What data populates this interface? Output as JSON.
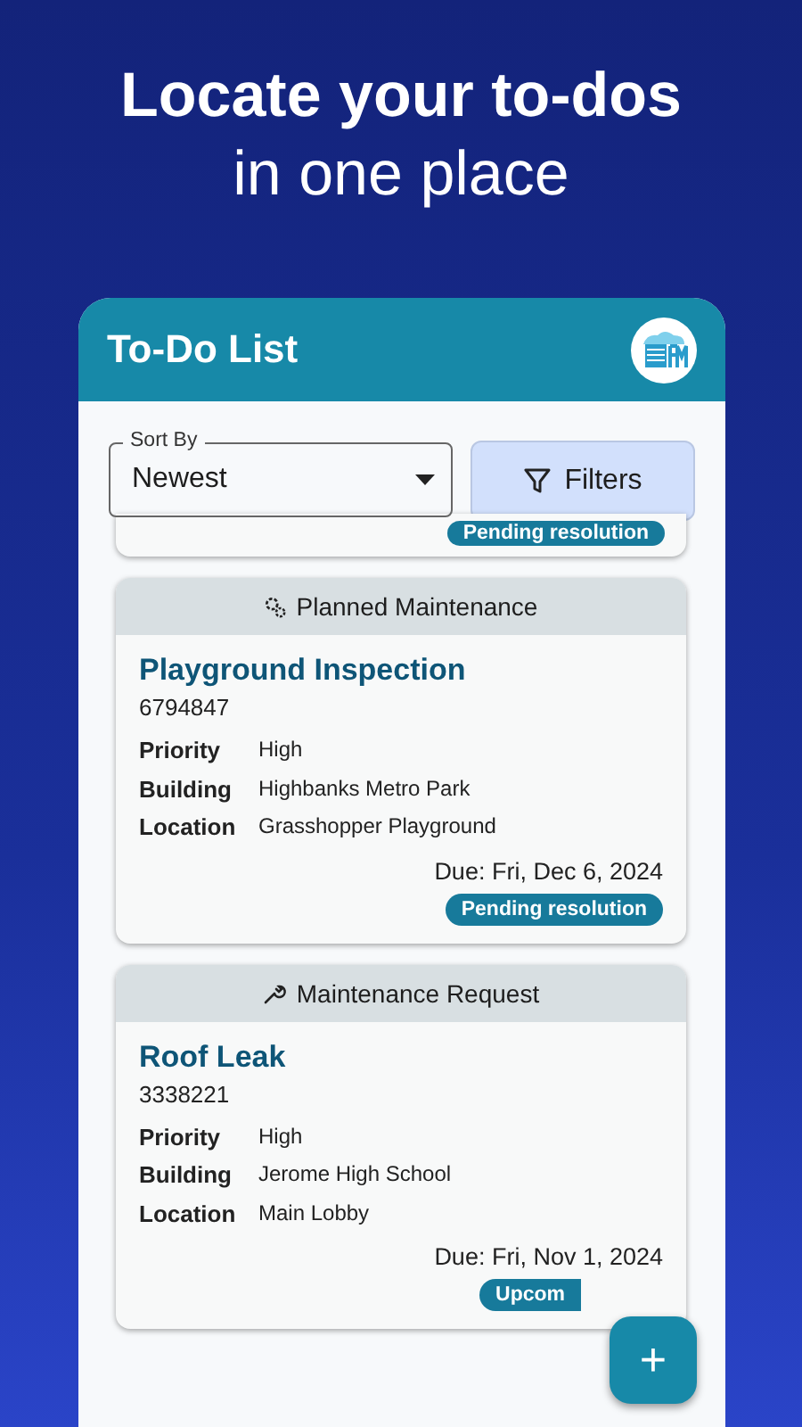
{
  "headline": {
    "line_1": "Locate your to-dos",
    "line_2": "in one place"
  },
  "app": {
    "title": "To-Do List",
    "sort": {
      "label": "Sort By",
      "value": "Newest"
    },
    "filters_button": "Filters"
  },
  "partial_card": {
    "status": "Pending resolution"
  },
  "cards": [
    {
      "kind": "planned",
      "type_label": "Planned Maintenance",
      "title": "Playground Inspection",
      "number": "6794847",
      "fields": [
        {
          "label": "Priority",
          "value": "High"
        },
        {
          "label": "Building",
          "value": "Highbanks Metro Park"
        },
        {
          "label": "Location",
          "value": "Grasshopper Playground"
        }
      ],
      "due": "Due: Fri, Dec 6, 2024",
      "status": "Pending resolution"
    },
    {
      "kind": "request",
      "type_label": "Maintenance Request",
      "title": "Roof Leak",
      "number": "3338221",
      "fields": [
        {
          "label": "Priority",
          "value": "High"
        },
        {
          "label": "Building",
          "value": "Jerome High School"
        },
        {
          "label": "Location",
          "value": "Main Lobby"
        }
      ],
      "due": "Due: Fri, Nov 1, 2024",
      "status": "Upcom"
    }
  ],
  "fab": "+"
}
